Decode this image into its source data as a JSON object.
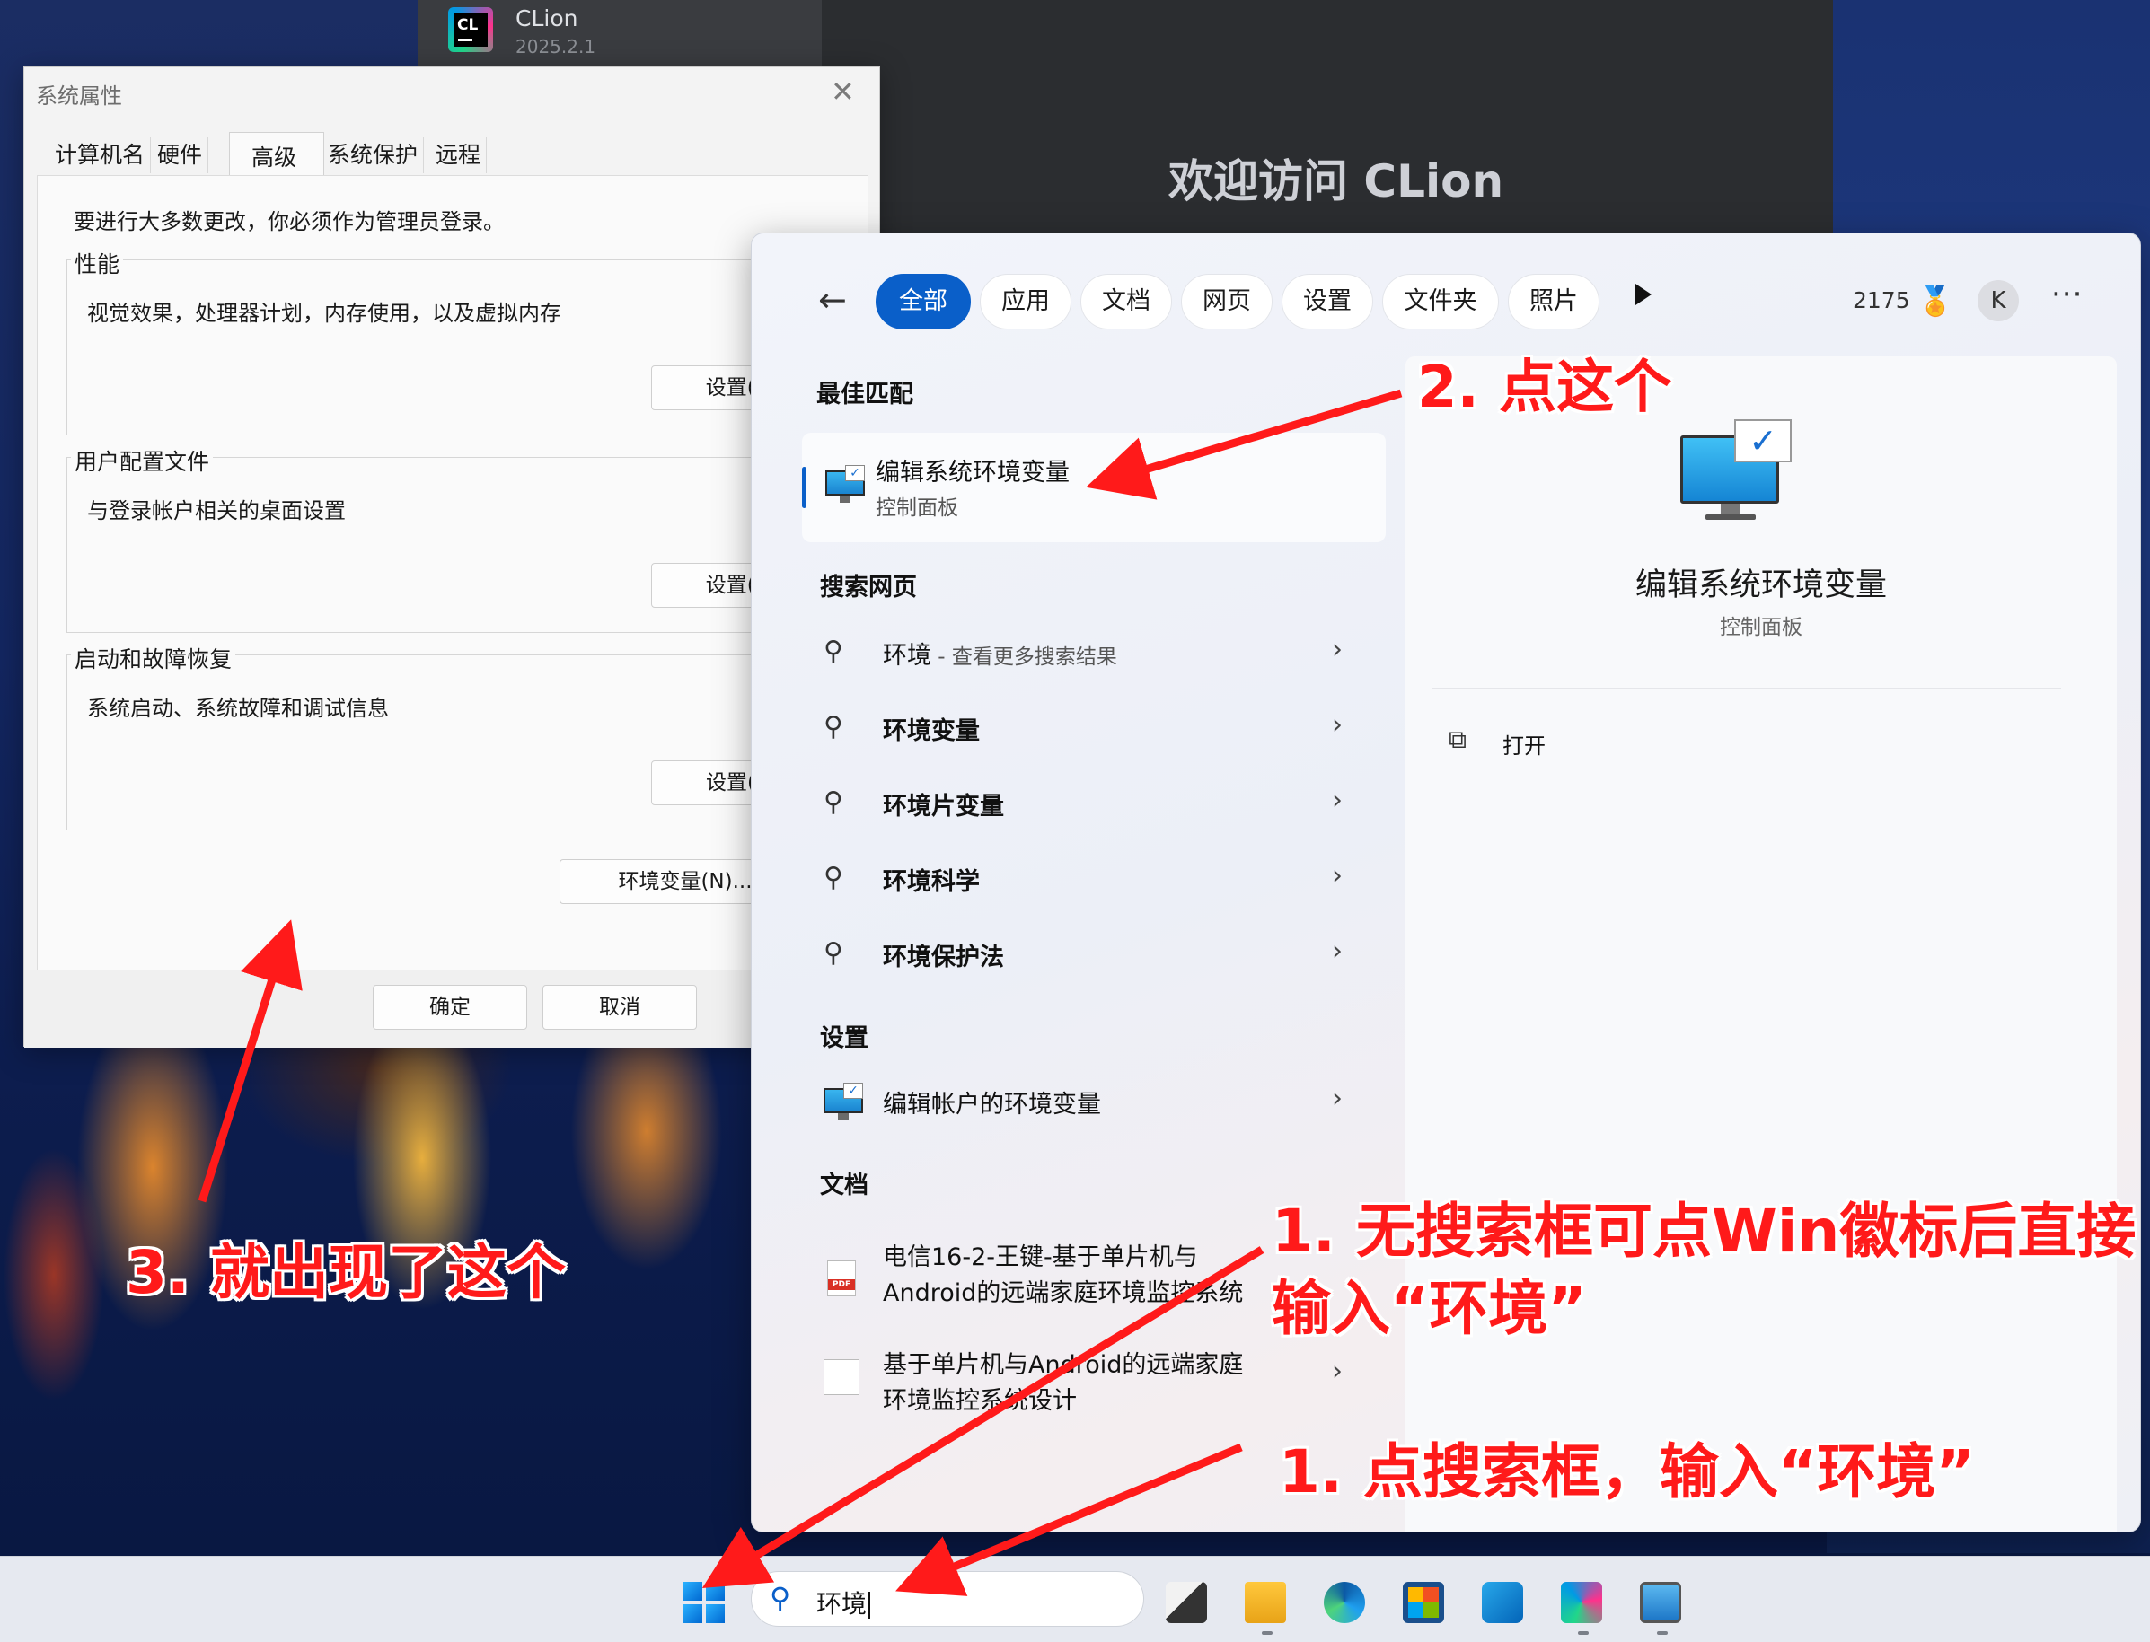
{
  "clion": {
    "name": "CLion",
    "version": "2025.2.1",
    "welcome": "欢迎访问 CLion",
    "logo_text": "CL"
  },
  "sysprop": {
    "title": "系统属性",
    "tabs": [
      "计算机名",
      "硬件",
      "高级",
      "系统保护",
      "远程"
    ],
    "admin_note": "要进行大多数更改，你必须作为管理员登录。",
    "performance": {
      "label": "性能",
      "desc": "视觉效果，处理器计划，内存使用，以及虚拟内存",
      "button": "设置(S)"
    },
    "profiles": {
      "label": "用户配置文件",
      "desc": "与登录帐户相关的桌面设置",
      "button": "设置(E)"
    },
    "startup": {
      "label": "启动和故障恢复",
      "desc": "系统启动、系统故障和调试信息",
      "button": "设置(T)"
    },
    "env_button": "环境变量(N)...",
    "ok": "确定",
    "cancel": "取消"
  },
  "search": {
    "filters": [
      "全部",
      "应用",
      "文档",
      "网页",
      "设置",
      "文件夹",
      "照片"
    ],
    "points": "2175",
    "avatar": "K",
    "best_match_heading": "最佳匹配",
    "best_match": {
      "title": "编辑系统环境变量",
      "sub": "控制面板"
    },
    "web_heading": "搜索网页",
    "web_first": {
      "term": "环境",
      "hint": " - 查看更多搜索结果"
    },
    "web_results": [
      "环境变量",
      "环境片变量",
      "环境科学",
      "环境保护法"
    ],
    "settings_heading": "设置",
    "settings_result": "编辑帐户的环境变量",
    "docs_heading": "文档",
    "doc1": {
      "line1": "电信16-2-王键-基于单片机与",
      "line2": "Android的远端家庭环境监控系统"
    },
    "doc2": {
      "line1": "基于单片机与Android的远端家庭",
      "line2": "环境监控系统设计"
    },
    "preview": {
      "title": "编辑系统环境变量",
      "sub": "控制面板",
      "open": "打开"
    }
  },
  "taskbar": {
    "search_text": "环境"
  },
  "annotations": {
    "a1": "2. 点这个",
    "a2": "1. 无搜索框可点Win徽标后直接",
    "a3": "输入“环境”",
    "a4": "1. 点搜索框，输入“环境”",
    "a5": "3. 就出现了这个",
    "color": "#ff1a1a"
  },
  "icons": {
    "back": "back-arrow-icon",
    "search": "search-icon",
    "chevron": "chevron-right-icon",
    "open": "open-external-icon"
  }
}
